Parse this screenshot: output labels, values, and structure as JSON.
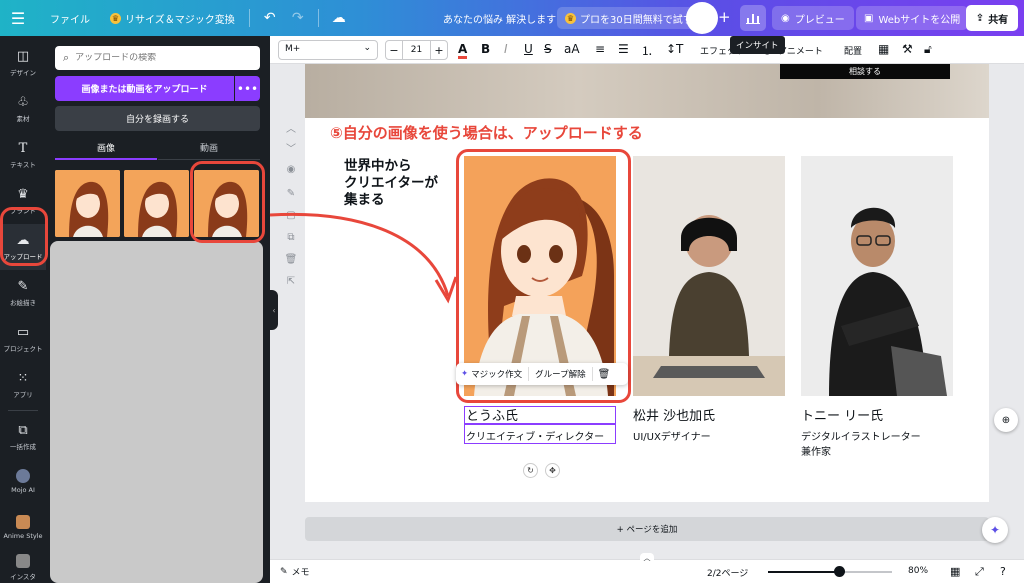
{
  "topbar": {
    "file_label": "ファイル",
    "resize_label": "リサイズ＆マジック変換",
    "doc_title": "あなたの悩み 解決します",
    "trial_label": "プロを30日間無料で試す",
    "preview_label": "プレビュー",
    "publish_label": "Webサイトを公開",
    "share_label": "共有",
    "insight_tooltip": "インサイト"
  },
  "rail": {
    "items": [
      {
        "label": "デザイン",
        "icon": "layout-icon"
      },
      {
        "label": "素材",
        "icon": "elements-icon"
      },
      {
        "label": "テキスト",
        "icon": "text-icon"
      },
      {
        "label": "ブランド",
        "icon": "brand-icon"
      },
      {
        "label": "アップロード",
        "icon": "upload-cloud-icon"
      },
      {
        "label": "お絵描き",
        "icon": "draw-icon"
      },
      {
        "label": "プロジェクト",
        "icon": "folder-icon"
      },
      {
        "label": "アプリ",
        "icon": "apps-icon"
      },
      {
        "label": "一括作成",
        "icon": "bulk-create-icon"
      },
      {
        "label": "Mojo AI",
        "icon": "mojo-ai-icon"
      },
      {
        "label": "Anime Style",
        "icon": "anime-style-icon"
      },
      {
        "label": "インスタ",
        "icon": "insta-icon"
      }
    ]
  },
  "panel": {
    "search_placeholder": "アップロードの検索",
    "upload_label": "画像または動画をアップロード",
    "more_label": "•••",
    "record_label": "自分を録画する",
    "tab_images": "画像",
    "tab_videos": "動画"
  },
  "format": {
    "font_name": "M+",
    "font_size": "21",
    "effects_label": "エフェクト",
    "animate_label": "アニメート",
    "position_label": "配置"
  },
  "page": {
    "hero_button": "相談する",
    "annotation_title": "⑤自分の画像を使う場合は、アップロードする",
    "annotation_left_lines": [
      "世界中から",
      "クリエイターが",
      "集まる"
    ],
    "people": [
      {
        "name": "とうふ氏",
        "role": "クリエイティブ・ディレクター"
      },
      {
        "name": "松井 沙也加氏",
        "role": "UI/UXデザイナー"
      },
      {
        "name": "トニー リー氏",
        "role_lines": [
          "デジタルイラストレーター",
          "兼作家"
        ]
      }
    ],
    "mini_toolbar": {
      "magic_write": "マジック作文",
      "ungroup": "グループ解除"
    },
    "add_page_label": "+ ページを追加"
  },
  "bottombar": {
    "notes_label": "メモ",
    "page_indicator": "2/2ページ",
    "zoom_percent": 80,
    "zoom_label": "80%"
  },
  "colors": {
    "brand_purple": "#8b3dff",
    "annotation_red": "#e8473b"
  }
}
